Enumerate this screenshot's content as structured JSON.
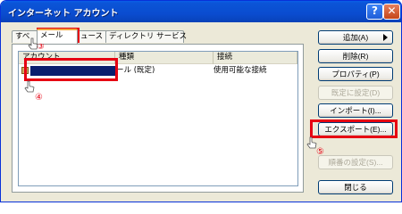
{
  "window": {
    "title": "インターネット アカウント"
  },
  "titlebar": {
    "help_glyph": "?",
    "close_glyph": "✕"
  },
  "tabs": [
    {
      "label": "すべ"
    },
    {
      "label": "メール"
    },
    {
      "label": "ュース"
    },
    {
      "label": "ディレクトリ サービス"
    }
  ],
  "list": {
    "columns": [
      "アカウント",
      "種類",
      "接続"
    ],
    "rows": [
      {
        "account": "",
        "type": "ール (既定)",
        "connection": "使用可能な接続"
      }
    ]
  },
  "buttons": {
    "add": "追加(A)",
    "remove": "削除(R)",
    "properties": "プロパティ(P)",
    "set_default": "既定に設定(D)",
    "import": "インポート(I)...",
    "export": "エクスポート(E)...",
    "order": "順番の設定(S)...",
    "close": "閉じる"
  },
  "callouts": {
    "c3": "③",
    "c4": "④",
    "c5": "⑤"
  },
  "colors": {
    "highlight_red": "#e60012",
    "titlebar_blue": "#0a4cd0"
  },
  "icons": [
    "help-icon",
    "close-icon",
    "account-icon",
    "pointer-icon",
    "arrow-right-icon"
  ]
}
